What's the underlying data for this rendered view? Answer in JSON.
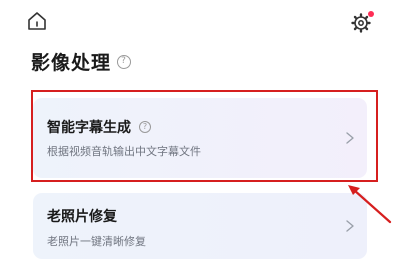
{
  "header": {
    "home_icon": "home-icon",
    "settings_icon": "gear-icon",
    "settings_badge_color": "#ff2d55"
  },
  "section": {
    "title": "影像处理",
    "help_glyph": "?"
  },
  "cards": [
    {
      "title": "智能字幕生成",
      "help_glyph": "?",
      "description": "根据视频音轨输出中文字幕文件",
      "chevron": "chevron-right-icon"
    },
    {
      "title": "老照片修复",
      "description": "老照片一键清晰修复",
      "chevron": "chevron-right-icon"
    }
  ],
  "annotation": {
    "highlight_color": "#d61f1f"
  }
}
